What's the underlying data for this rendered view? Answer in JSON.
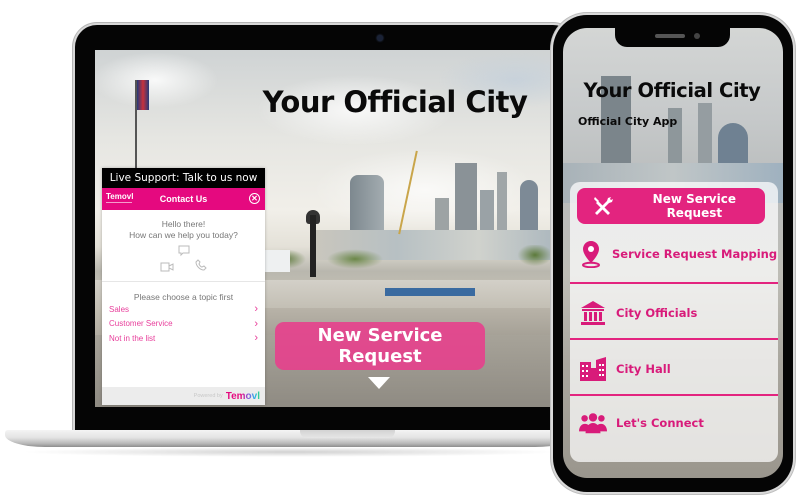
{
  "desktop": {
    "page_title": "Your Official City",
    "hero_button_label": "New Service Request",
    "scroll_hint_icon": "triangle-down-icon",
    "chat_widget": {
      "banner": "Live Support: Talk to us now",
      "logo": "Temovl",
      "header_title": "Contact Us",
      "close_icon": "close-circle-icon",
      "greeting_line1": "Hello there!",
      "greeting_line2": "How can we help you today?",
      "channel_icons": [
        "chat-bubble-icon",
        "video-camera-icon",
        "phone-icon"
      ],
      "prompt": "Please choose a topic first",
      "topics": [
        {
          "label": "Sales"
        },
        {
          "label": "Customer Service"
        },
        {
          "label": "Not in the list"
        }
      ],
      "footer_powered": "Powered by",
      "footer_brand": "Temovl"
    }
  },
  "mobile": {
    "app_title": "Your Official City",
    "app_subtitle": "Official City App",
    "primary_action": {
      "label": "New Service Request",
      "icon": "tools-icon"
    },
    "menu_items": [
      {
        "label": "Service Request Mapping",
        "icon": "map-pin-icon"
      },
      {
        "label": "City Officials",
        "icon": "government-building-icon"
      },
      {
        "label": "City Hall",
        "icon": "city-buildings-icon"
      },
      {
        "label": "Let's Connect",
        "icon": "users-group-icon"
      }
    ]
  },
  "colors": {
    "brand_pink": "#e3247f",
    "chat_header_pink": "#e5097f",
    "topic_pink": "#e83e9b",
    "menu_text_pink": "#d81b7a",
    "title_black": "#0a0a0a"
  }
}
